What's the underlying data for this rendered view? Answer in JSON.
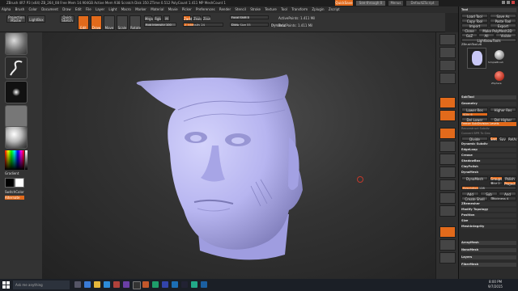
{
  "titlebar": {
    "text": "ZBrush 4R7 P3 (x64)   ZB_264_08   Free Mem 14.904GB  Active Mem 938  Scratch Disk 350  ZTime 0.512  PolyCount 1.411 MP  MeshCount 1",
    "quicksave": "QuickSave",
    "seethrough": "See-through 0",
    "menus_label": "Menus",
    "default_script": "DefaultZScript"
  },
  "menubar": [
    "Alpha",
    "Brush",
    "Color",
    "Document",
    "Draw",
    "Edit",
    "File",
    "Layer",
    "Light",
    "Macro",
    "Marker",
    "Material",
    "Movie",
    "Picker",
    "Preferences",
    "Render",
    "Stencil",
    "Stroke",
    "Texture",
    "Tool",
    "Transform",
    "Zplugin",
    "Zscript"
  ],
  "topbar": {
    "projection_master": "Projection Master",
    "lightbox": "LightBox",
    "quick_sketch": "Quick Sketch",
    "edit": "Edit",
    "draw": "Draw",
    "move": "Move",
    "scale": "Scale",
    "rotate": "Rotate",
    "mrgb": "Mrgb",
    "rgb": "Rgb",
    "m": "M",
    "rgb_intensity": "Rgb Intensity 100",
    "zadd": "Zadd",
    "zsub": "Zsub",
    "zcut": "Zcut",
    "z_intensity": "Z Intensity 24",
    "focal_shift": "Focal Shift 0",
    "draw_size": "Draw Size 55",
    "dynamic": "Dynamic",
    "active_points": "ActivePoints: 1.411 Mil",
    "total_points": "TotalPoints: 1.411 Mil"
  },
  "leftbar": {
    "gradient": "Gradient",
    "switch_color": "SwitchColor",
    "alternate": "Alternate"
  },
  "rightpanel": {
    "title": "Tool",
    "load_tool": "Load Tool",
    "save_as": "Save As",
    "copy_tool": "Copy Tool",
    "paste_tool": "Paste Tool",
    "import": "Import",
    "export": "Export",
    "clone": "Clone",
    "make_polymesh": "Make PolyMesh3D",
    "goz": "GoZ",
    "all": "All",
    "visible": "Visible",
    "lightbox_tools": "Lightbox▸Tools",
    "tool_name": "ZBrushTool.ztl",
    "subtool": "SubTool",
    "geometry": "Geometry",
    "lower_res": "Lower Res",
    "higher_res": "Higher Res",
    "sdiv": "SDiv 6",
    "del_lower": "Del Lower",
    "del_higher": "Del Higher",
    "freeze_sub": "Freeze SubDivision Levels",
    "reconstruct": "Reconstruct Subdiv",
    "convert_bpr": "Convert BPR To Geo",
    "divide": "Divide",
    "smt": "Smt",
    "suv": "Suv",
    "rsuv": "ReUV",
    "dynamic_subdiv": "Dynamic Subdiv",
    "edgeloop": "EdgeLoop",
    "crease": "Crease",
    "shadowbox": "ShadowBox",
    "claypolish": "ClayPolish",
    "dynamesh_hdr": "DynaMesh",
    "dynamesh": "DynaMesh",
    "groups": "Groups",
    "polish": "Polish",
    "blur": "Blur 2",
    "project": "Project",
    "resolution": "Resolution 128",
    "add": "Add",
    "sub": "Sub",
    "and": "And",
    "create_shell": "Create Shell",
    "thickness": "Thickness 4",
    "zremesher": "ZRemesher",
    "modify_topology": "Modify Topology",
    "position": "Position",
    "size": "Size",
    "meshintegrity": "MeshIntegrity",
    "arraymesh": "ArrayMesh",
    "nanomesh": "NanoMesh",
    "layers": "Layers",
    "fibermesh": "FiberMesh",
    "thumb_label_1": "SimpleBrush",
    "thumb_label_2": "ZSphere"
  },
  "taskbar": {
    "search": "Ask me anything",
    "time": "8:00 PM",
    "date": "9/7/2015"
  },
  "colors": {
    "accent": "#e26a1b",
    "mesh": "#b7b5f0"
  }
}
